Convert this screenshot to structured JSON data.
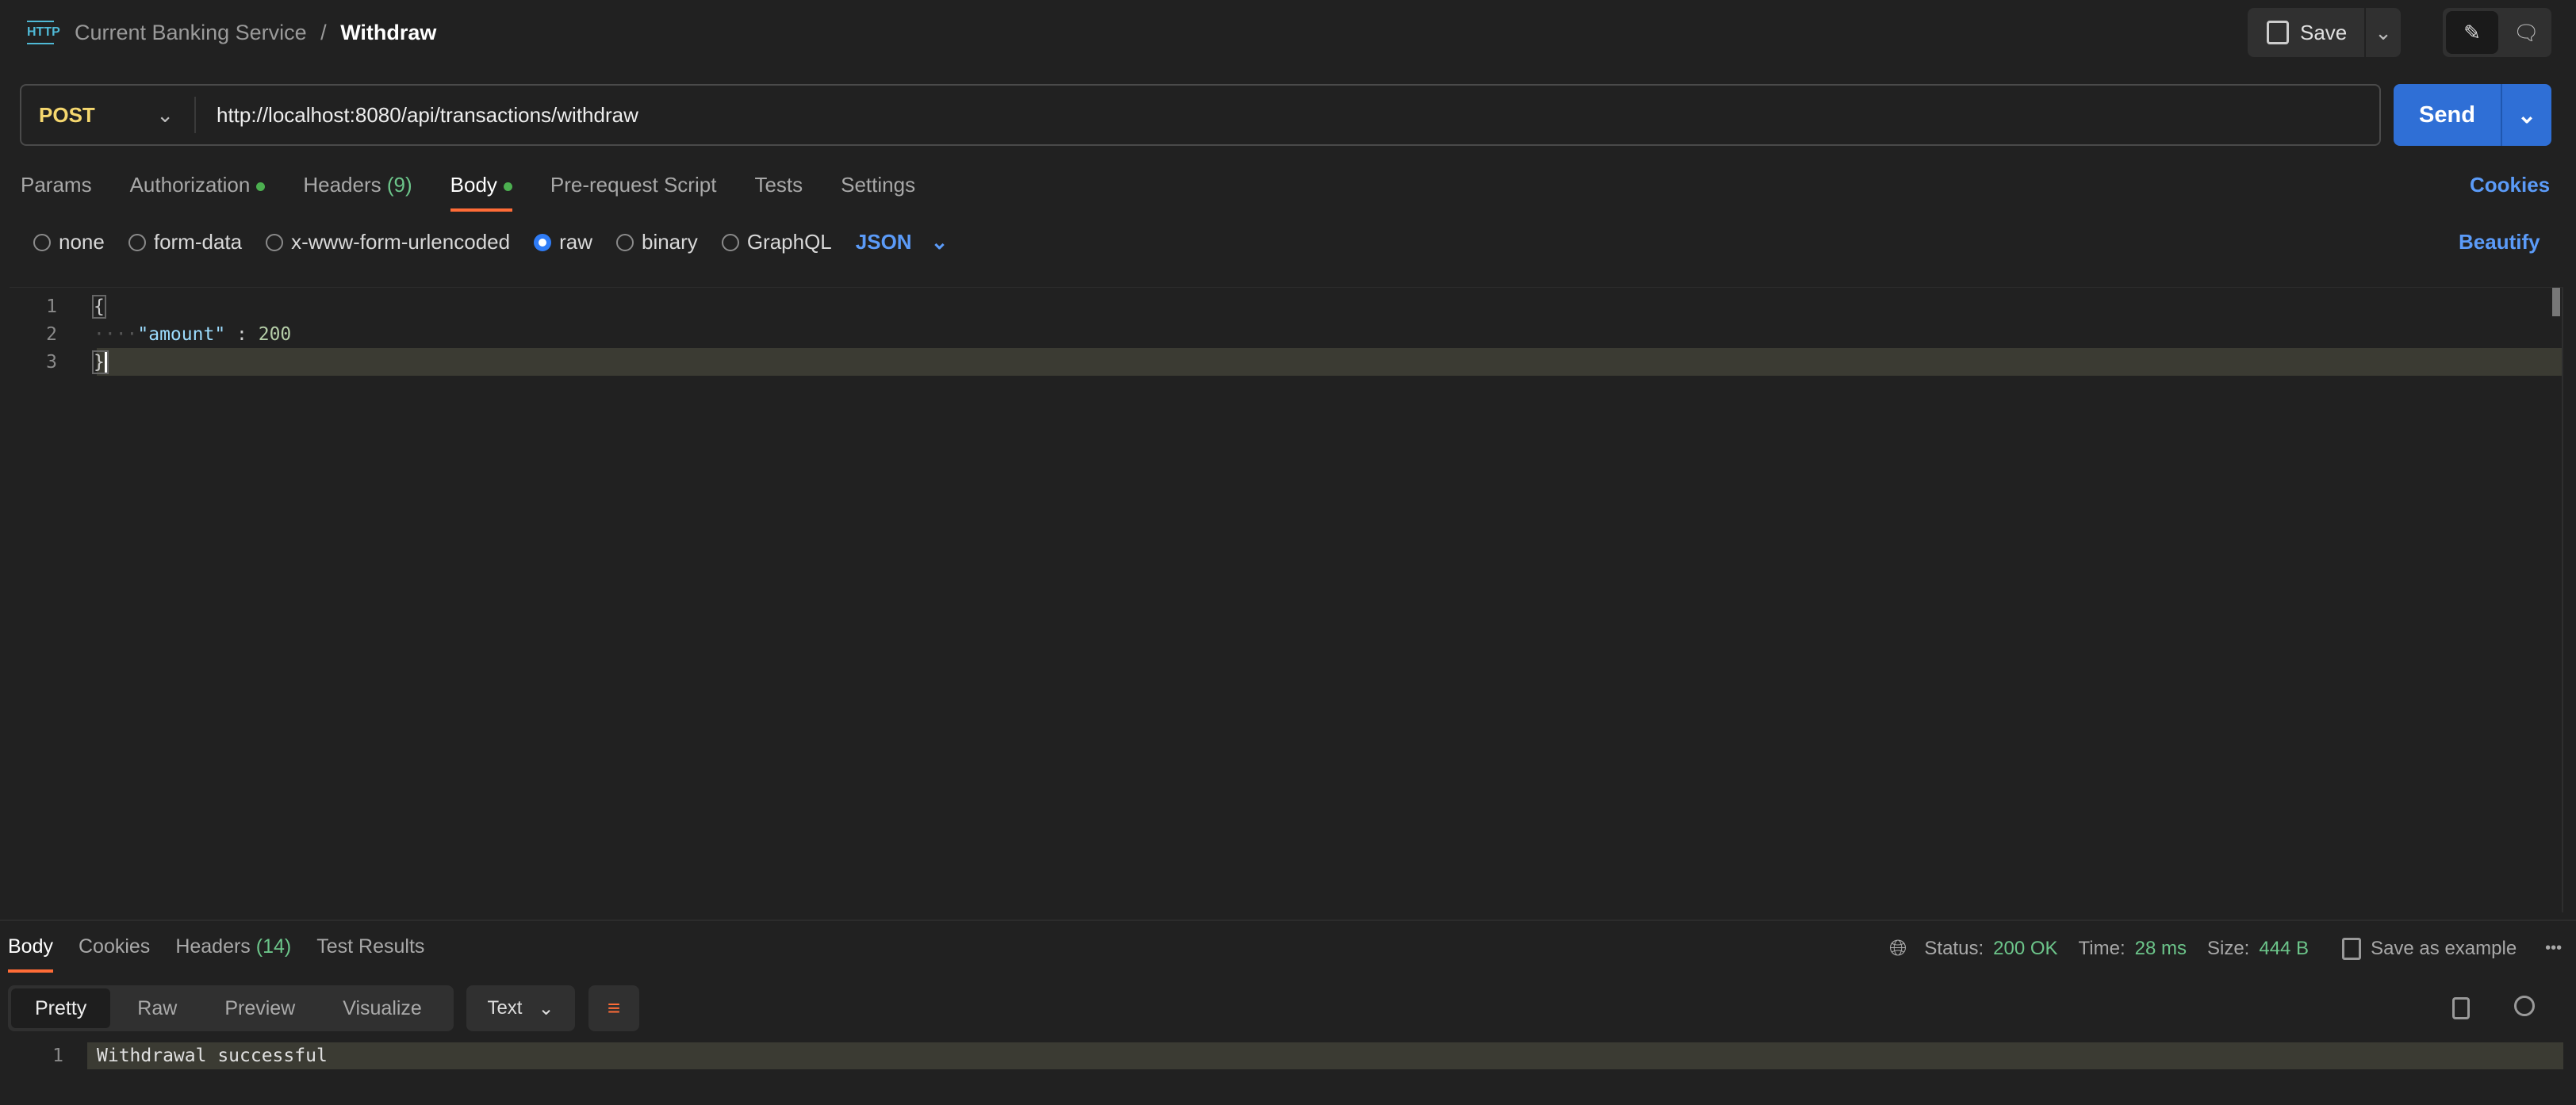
{
  "header": {
    "icon": "http-icon",
    "collection": "Current Banking Service",
    "separator": "/",
    "request": "Withdraw",
    "save_label": "Save"
  },
  "request": {
    "method": "POST",
    "url": "http://localhost:8080/api/transactions/withdraw",
    "send_label": "Send"
  },
  "tabs": {
    "params": "Params",
    "authorization": "Authorization",
    "headers": "Headers",
    "headers_count": "(9)",
    "body": "Body",
    "prerequest": "Pre-request Script",
    "tests": "Tests",
    "settings": "Settings",
    "cookies": "Cookies",
    "active": "Body"
  },
  "body_options": {
    "none": "none",
    "form_data": "form-data",
    "urlencoded": "x-www-form-urlencoded",
    "raw": "raw",
    "binary": "binary",
    "graphql": "GraphQL",
    "format": "JSON",
    "selected": "raw",
    "beautify": "Beautify"
  },
  "editor": {
    "lines": [
      {
        "n": "1",
        "text": "{"
      },
      {
        "n": "2",
        "key": "\"amount\"",
        "colon": " : ",
        "value": "200"
      },
      {
        "n": "3",
        "text": "}"
      }
    ]
  },
  "response": {
    "tabs": {
      "body": "Body",
      "cookies": "Cookies",
      "headers": "Headers",
      "headers_count": "(14)",
      "tests": "Test Results"
    },
    "status_label": "Status:",
    "status": "200 OK",
    "time_label": "Time:",
    "time": "28 ms",
    "size_label": "Size:",
    "size": "444 B",
    "save_example": "Save as example",
    "views": {
      "pretty": "Pretty",
      "raw": "Raw",
      "preview": "Preview",
      "visualize": "Visualize"
    },
    "format": "Text",
    "lines": [
      {
        "n": "1",
        "text": "Withdrawal successful"
      }
    ]
  },
  "colors": {
    "accent": "#ff6c37",
    "send": "#2f6fd6",
    "link": "#5b9bf8",
    "method": "#f5d76e",
    "success": "#6cc58a"
  }
}
